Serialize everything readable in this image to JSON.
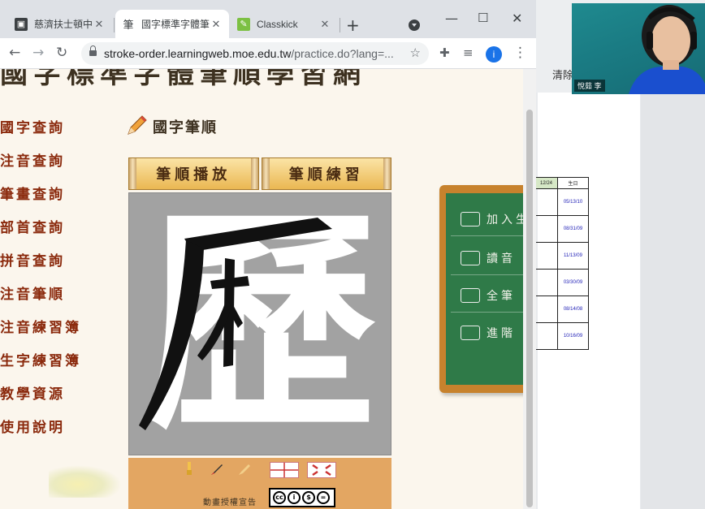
{
  "browser": {
    "tabs": [
      {
        "title": "慈濟扶士頓中文",
        "favicon": "contact-card-icon",
        "active": false
      },
      {
        "title": "國字標準字體筆",
        "favicon": "stroke-char-icon",
        "active": true
      },
      {
        "title": "Classkick",
        "favicon": "classkick-icon",
        "active": false
      }
    ],
    "url_host": "stroke-order.learningweb.moe.edu.tw",
    "url_path": "/practice.do?lang=...",
    "profile_initial": "i"
  },
  "page": {
    "site_title": "國字標準字體筆順學習網",
    "sidebar": [
      {
        "label": "國字查詢"
      },
      {
        "label": "注音查詢"
      },
      {
        "label": "筆畫查詢"
      },
      {
        "label": "部首查詢"
      },
      {
        "label": "拼音查詢"
      },
      {
        "label": "注音筆順"
      },
      {
        "label": "注音練習簿"
      },
      {
        "label": "生字練習簿"
      },
      {
        "label": "教學資源"
      },
      {
        "label": "使用說明"
      }
    ],
    "section_title": "國字筆順",
    "mode_tabs": [
      {
        "label": "筆順播放"
      },
      {
        "label": "筆順練習"
      }
    ],
    "character": "歷",
    "license_text": "動畫授權宣告",
    "chalkboard": [
      {
        "label": "加入生",
        "icon": "book-icon"
      },
      {
        "label": "讀音",
        "icon": "speaker-icon"
      },
      {
        "label": "全筆",
        "icon": "lightbulb-icon"
      },
      {
        "label": "進階",
        "icon": "eye-icon"
      }
    ]
  },
  "right_panel": {
    "label": "清除",
    "table_headers": [
      "12/24",
      "生日"
    ],
    "table_rows": [
      "05/13/10",
      "08/31/09",
      "11/13/09",
      "03/30/09",
      "08/14/08",
      "10/16/09"
    ],
    "webcam_name": "悅茹 李"
  },
  "colors": {
    "sidebar_text": "#8b2a0d",
    "canvas_bg": "#a2a2a2",
    "chalkboard": "#2f7a48",
    "control_bar": "#e3a662"
  }
}
